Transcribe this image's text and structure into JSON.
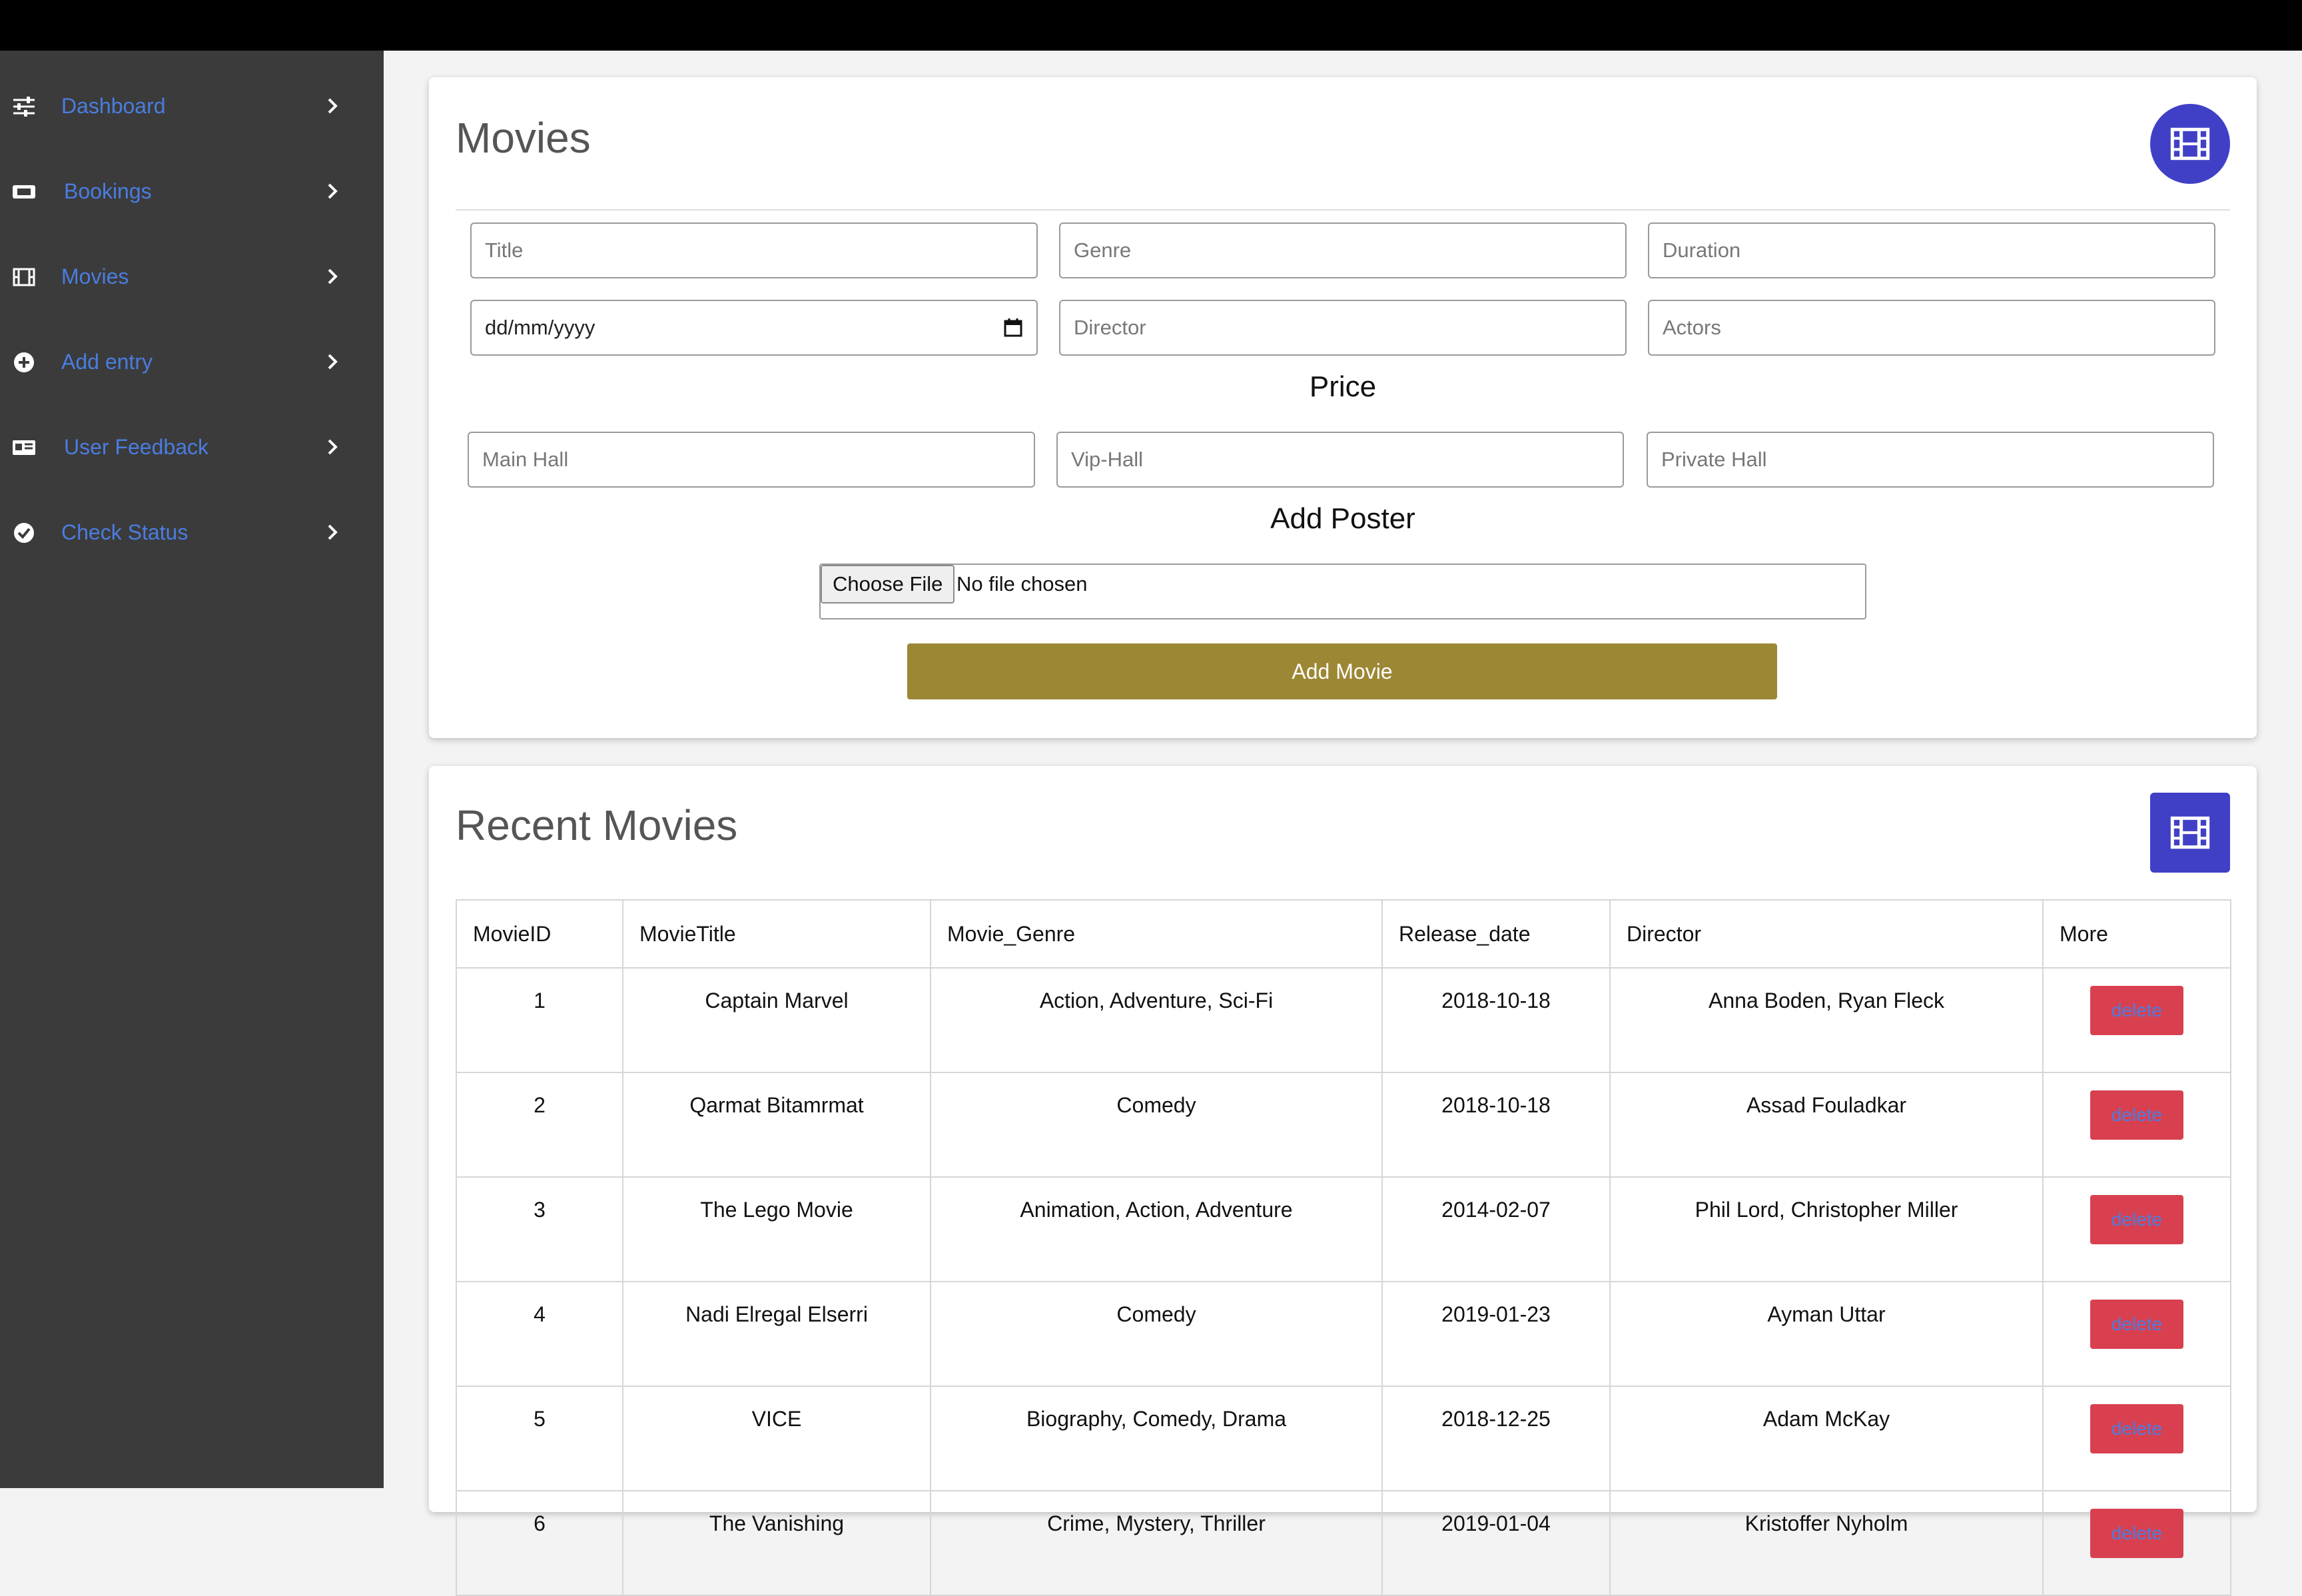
{
  "sidebar": {
    "items": [
      {
        "label": "Dashboard",
        "icon": "sliders-icon"
      },
      {
        "label": "Bookings",
        "icon": "ticket-icon"
      },
      {
        "label": "Movies",
        "icon": "film-icon"
      },
      {
        "label": "Add entry",
        "icon": "plus-circle-icon"
      },
      {
        "label": "User Feedback",
        "icon": "id-card-icon"
      },
      {
        "label": "Check Status",
        "icon": "check-circle-icon"
      }
    ]
  },
  "movies_form": {
    "title": "Movies",
    "fields": {
      "title_placeholder": "Title",
      "genre_placeholder": "Genre",
      "duration_placeholder": "Duration",
      "date_value": "dd/mm/yyyy",
      "director_placeholder": "Director",
      "actors_placeholder": "Actors"
    },
    "price_label": "Price",
    "price_fields": {
      "main_hall_placeholder": "Main Hall",
      "vip_hall_placeholder": "Vip-Hall",
      "private_hall_placeholder": "Private Hall"
    },
    "poster_label": "Add Poster",
    "file_button_label": "Choose File",
    "file_status": "No file chosen",
    "submit_label": "Add Movie"
  },
  "recent_movies": {
    "title": "Recent Movies",
    "columns": [
      "MovieID",
      "MovieTitle",
      "Movie_Genre",
      "Release_date",
      "Director",
      "More"
    ],
    "rows": [
      {
        "id": "1",
        "title": "Captain Marvel",
        "genre": "Action, Adventure, Sci-Fi",
        "release": "2018-10-18",
        "director": "Anna Boden, Ryan Fleck",
        "action": "delete"
      },
      {
        "id": "2",
        "title": "Qarmat Bitamrmat",
        "genre": "Comedy",
        "release": "2018-10-18",
        "director": "Assad Fouladkar",
        "action": "delete"
      },
      {
        "id": "3",
        "title": "The Lego Movie",
        "genre": "Animation, Action, Adventure",
        "release": "2014-02-07",
        "director": "Phil Lord, Christopher Miller",
        "action": "delete"
      },
      {
        "id": "4",
        "title": "Nadi Elregal Elserri",
        "genre": "Comedy",
        "release": "2019-01-23",
        "director": "Ayman Uttar",
        "action": "delete"
      },
      {
        "id": "5",
        "title": "VICE",
        "genre": "Biography, Comedy, Drama",
        "release": "2018-12-25",
        "director": "Adam McKay",
        "action": "delete"
      },
      {
        "id": "6",
        "title": "The Vanishing",
        "genre": "Crime, Mystery, Thriller",
        "release": "2019-01-04",
        "director": "Kristoffer Nyholm",
        "action": "delete"
      }
    ]
  },
  "colors": {
    "sidebar_bg": "#3b3b3b",
    "nav_link": "#4a7de0",
    "accent_blue": "#4040c7",
    "submit_bg": "#9c8734",
    "delete_bg": "#d9404f"
  }
}
